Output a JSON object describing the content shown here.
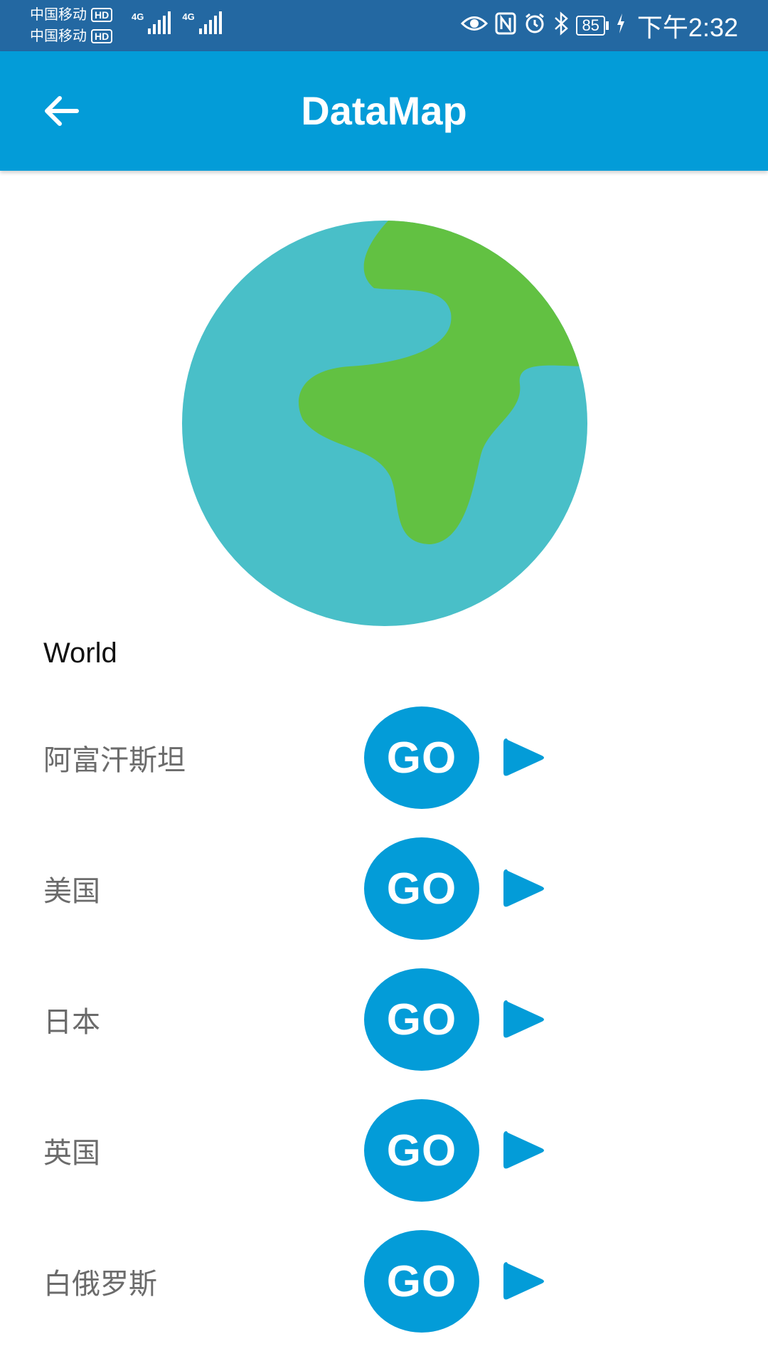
{
  "status_bar": {
    "carrier_1": "中国移动",
    "carrier_2": "中国移动",
    "hd_badge": "HD",
    "network_1": "4G",
    "network_2": "4G",
    "battery": "85",
    "time": "下午2:32"
  },
  "app_bar": {
    "title": "DataMap"
  },
  "main": {
    "section_label": "World",
    "countries": [
      {
        "name": "阿富汗斯坦",
        "go_label": "GO"
      },
      {
        "name": "美国",
        "go_label": "GO"
      },
      {
        "name": "日本",
        "go_label": "GO"
      },
      {
        "name": "英国",
        "go_label": "GO"
      },
      {
        "name": "白俄罗斯",
        "go_label": "GO"
      }
    ]
  },
  "colors": {
    "status_bar": "#2368a2",
    "accent": "#039cd8",
    "globe_ocean": "#49bfc8",
    "globe_land": "#62c142"
  },
  "icons": {
    "back": "arrow-back-icon",
    "globe": "earth-globe-icon",
    "play": "play-icon"
  }
}
